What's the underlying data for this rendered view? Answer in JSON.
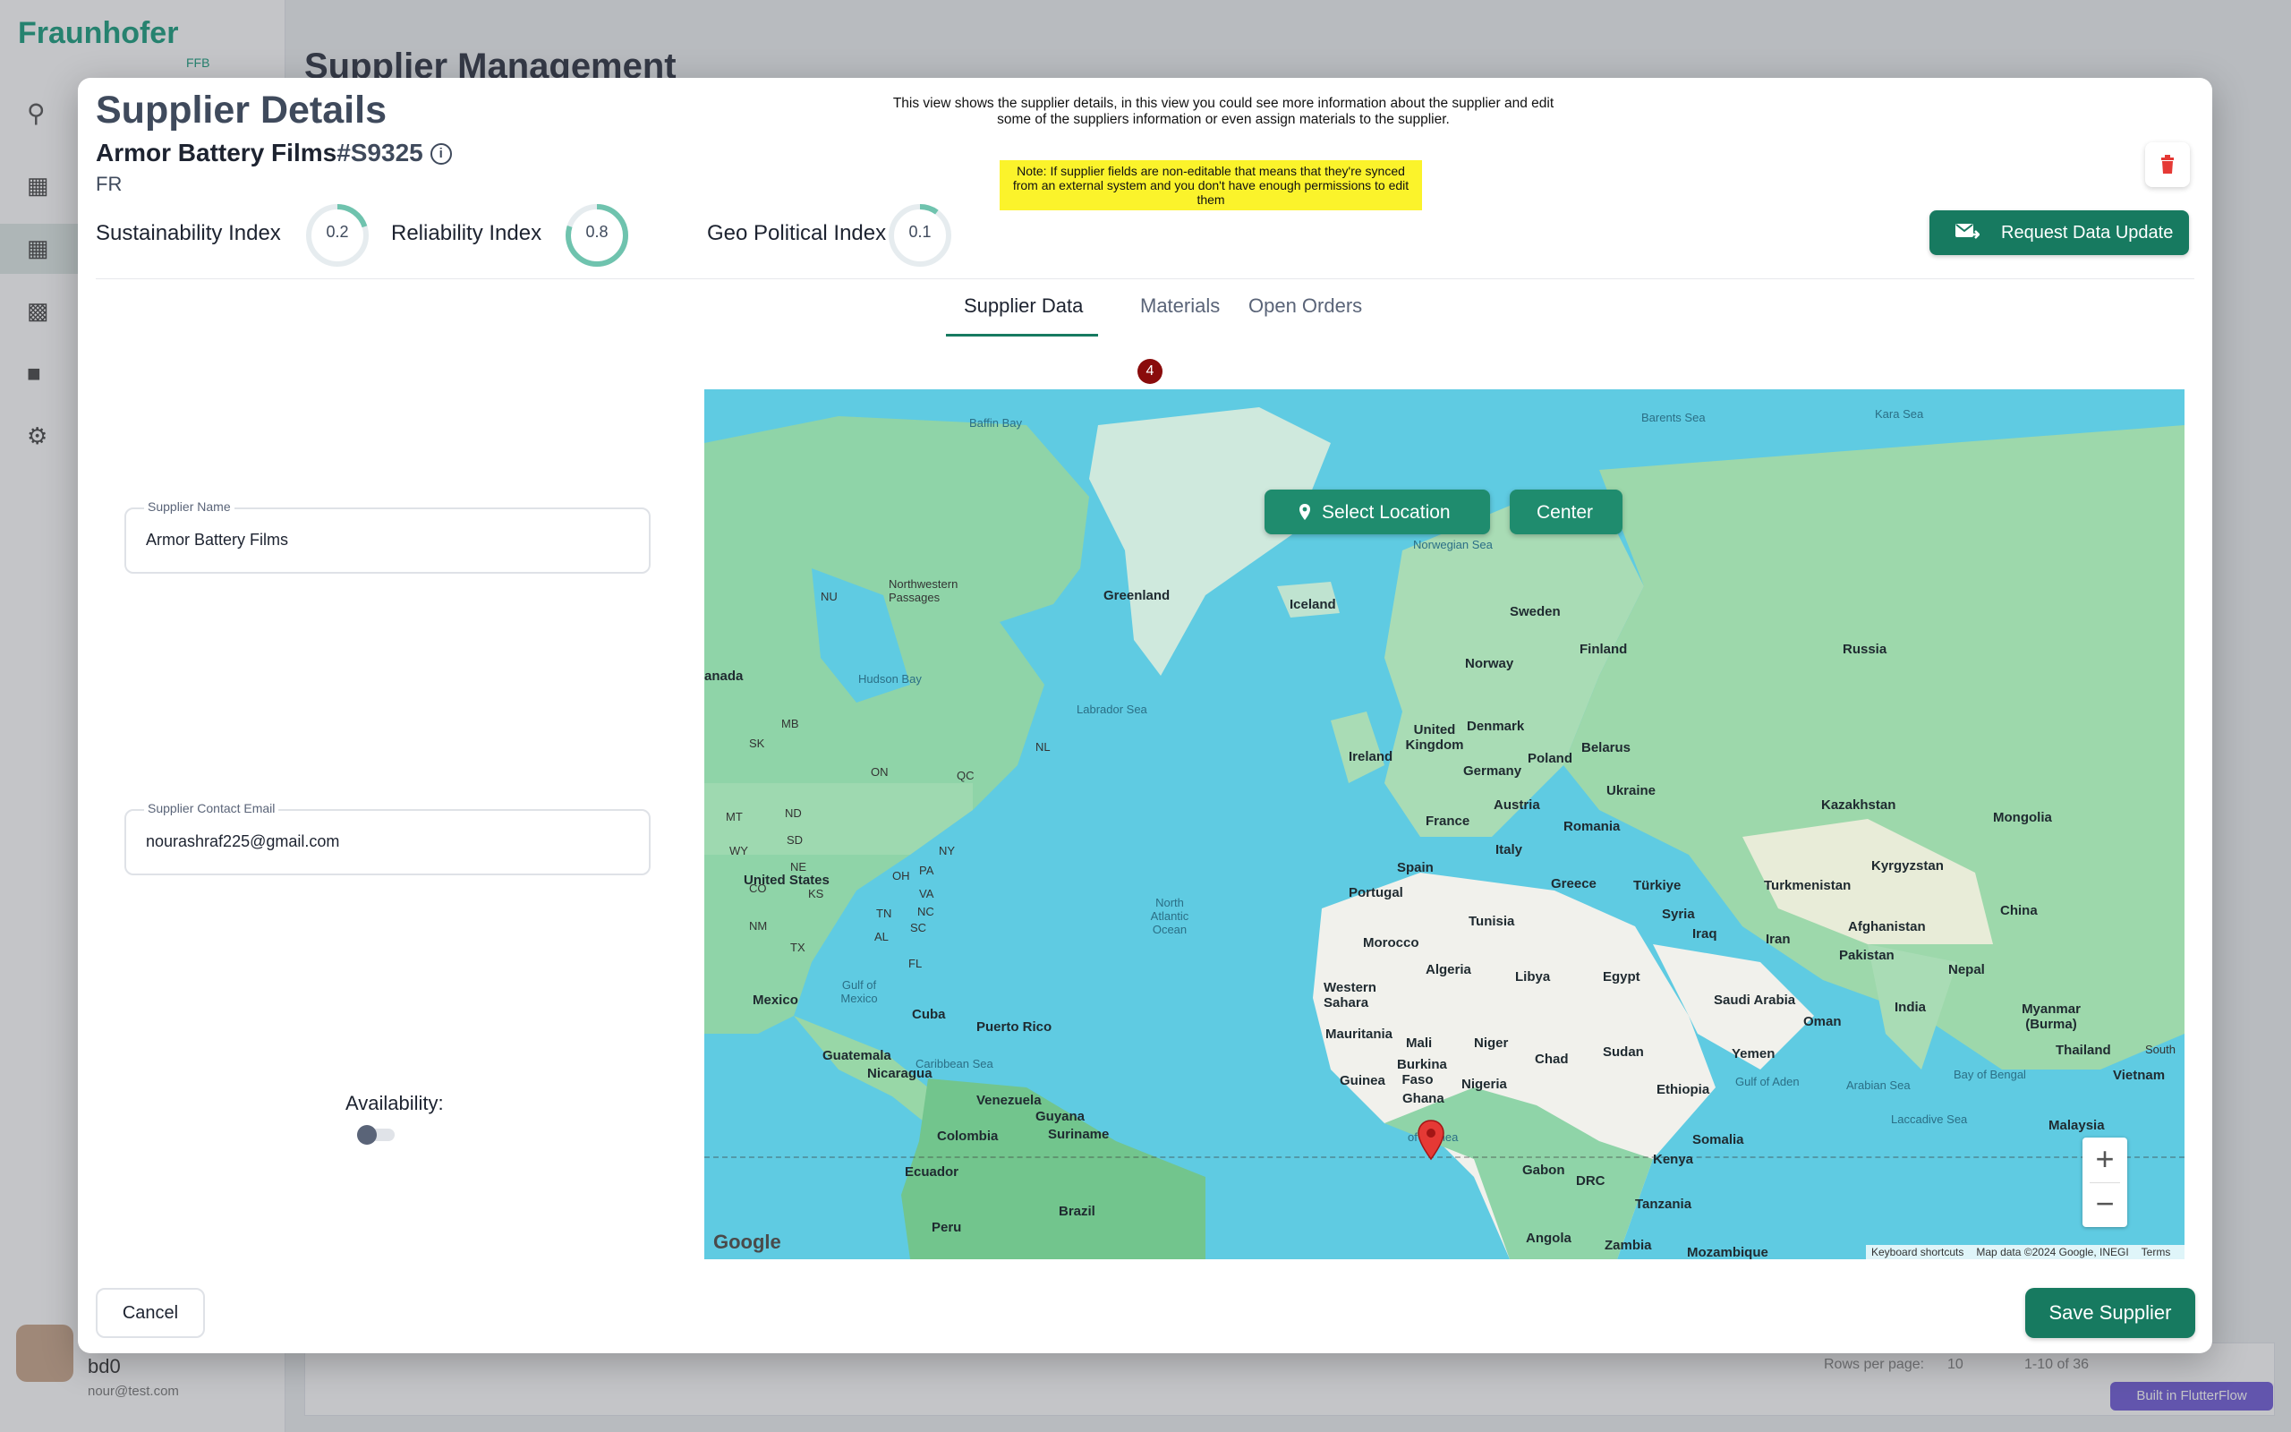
{
  "background": {
    "logo": "Fraunhofer",
    "logo_sub": "FFB",
    "page_title": "Supplier Management",
    "user_name": "bd0",
    "user_email": "nour@test.com",
    "rows_per_page_label": "Rows per page:",
    "rows_per_page_value": "10",
    "pagination": "1-10 of 36",
    "flutterflow_badge": "Built in FlutterFlow"
  },
  "dialog": {
    "title": "Supplier Details",
    "supplier_name": "Armor Battery Films",
    "supplier_id": "#S9325",
    "country": "FR",
    "description": "This view shows the supplier details, in this view you could see more information about the supplier and edit some of the suppliers information or even assign materials to the supplier.",
    "note": "Note: If supplier fields are non-editable that means that they're synced from an external system and you don't have enough permissions to edit them",
    "indices": [
      {
        "label": "Sustainability Index",
        "value": "0.2",
        "fraction": 0.2
      },
      {
        "label": "Reliability Index",
        "value": "0.8",
        "fraction": 0.8
      },
      {
        "label": "Geo Political Index",
        "value": "0.1",
        "fraction": 0.1
      }
    ],
    "request_button": "Request Data Update",
    "tabs": [
      {
        "label": "Supplier Data",
        "active": true
      },
      {
        "label": "Materials",
        "badge": "4"
      },
      {
        "label": "Open Orders"
      }
    ],
    "fields": {
      "name_label": "Supplier Name",
      "name_value": "Armor Battery Films",
      "email_label": "Supplier Contact Email",
      "email_value": "nourashraf225@gmail.com"
    },
    "availability_label": "Availability:",
    "availability_on": false,
    "cancel_button": "Cancel",
    "save_button": "Save Supplier"
  },
  "map": {
    "select_location_button": "Select Location",
    "center_button": "Center",
    "google_logo": "Google",
    "attribution": {
      "shortcuts": "Keyboard shortcuts",
      "map_data": "Map data ©2024 Google, INEGI",
      "terms": "Terms"
    },
    "labels": {
      "baffin_bay": "Baffin Bay",
      "barents_sea": "Barents Sea",
      "kara_sea": "Kara Sea",
      "greenland": "Greenland",
      "iceland": "Iceland",
      "norwegian_sea": "Norwegian Sea",
      "sweden": "Sweden",
      "finland": "Finland",
      "norway": "Norway",
      "russia": "Russia",
      "nu": "NU",
      "northwestern_passages": "Northwestern Passages",
      "canada": "anada",
      "hudson_bay": "Hudson Bay",
      "labrador_sea": "Labrador Sea",
      "ireland": "Ireland",
      "united_kingdom": "United Kingdom",
      "denmark": "Denmark",
      "belarus": "Belarus",
      "poland": "Poland",
      "germany": "Germany",
      "ukraine": "Ukraine",
      "kazakhstan": "Kazakhstan",
      "mongolia": "Mongolia",
      "france": "France",
      "austria": "Austria",
      "romania": "Romania",
      "italy": "Italy",
      "spain": "Spain",
      "portugal": "Portugal",
      "greece": "Greece",
      "turkiye": "Türkiye",
      "turkmenistan": "Turkmenistan",
      "kyrgyzstan": "Kyrgyzstan",
      "china": "China",
      "united_states": "United States",
      "north_atlantic": "North Atlantic Ocean",
      "tunisia": "Tunisia",
      "syria": "Syria",
      "iraq": "Iraq",
      "iran": "Iran",
      "afghanistan": "Afghanistan",
      "pakistan": "Pakistan",
      "nepal": "Nepal",
      "morocco": "Morocco",
      "algeria": "Algeria",
      "libya": "Libya",
      "egypt": "Egypt",
      "saudi_arabia": "Saudi Arabia",
      "oman": "Oman",
      "india": "India",
      "myanmar": "Myanmar (Burma)",
      "mexico": "Mexico",
      "gulf_of_mexico": "Gulf of Mexico",
      "cuba": "Cuba",
      "puerto_rico": "Puerto Rico",
      "western_sahara": "Western Sahara",
      "mauritania": "Mauritania",
      "mali": "Mali",
      "niger": "Niger",
      "chad": "Chad",
      "sudan": "Sudan",
      "yemen": "Yemen",
      "guatemala": "Guatemala",
      "caribbean_sea": "Caribbean Sea",
      "nicaragua": "Nicaragua",
      "burkina_faso": "Burkina Faso",
      "guinea": "Guinea",
      "ghana": "Ghana",
      "nigeria": "Nigeria",
      "ethiopia": "Ethiopia",
      "gulf_of_aden": "Gulf of Aden",
      "arabian_sea": "Arabian Sea",
      "bay_of_bengal": "Bay of Bengal",
      "thailand": "Thailand",
      "vietnam": "Vietnam",
      "venezuela": "Venezuela",
      "guyana": "Guyana",
      "suriname": "Suriname",
      "colombia": "Colombia",
      "gulf_of_guinea": "of Guinea",
      "somalia": "Somalia",
      "laccadive_sea": "Laccadive Sea",
      "malaysia": "Malaysia",
      "ecuador": "Ecuador",
      "gabon": "Gabon",
      "drc": "DRC",
      "kenya": "Kenya",
      "brazil": "Brazil",
      "peru": "Peru",
      "tanzania": "Tanzania",
      "angola": "Angola",
      "zambia": "Zambia",
      "mozambique": "Mozambique",
      "mb": "MB",
      "sk": "SK",
      "on": "ON",
      "qc": "QC",
      "nl": "NL",
      "mt": "MT",
      "nd": "ND",
      "sd": "SD",
      "wy": "WY",
      "ne": "NE",
      "co": "CO",
      "ks": "KS",
      "nm": "NM",
      "tx": "TX",
      "ny": "NY",
      "pa": "PA",
      "oh": "OH",
      "va": "VA",
      "tn": "TN",
      "nc": "NC",
      "sc": "SC",
      "al": "AL",
      "fl": "FL",
      "south": "South"
    }
  }
}
